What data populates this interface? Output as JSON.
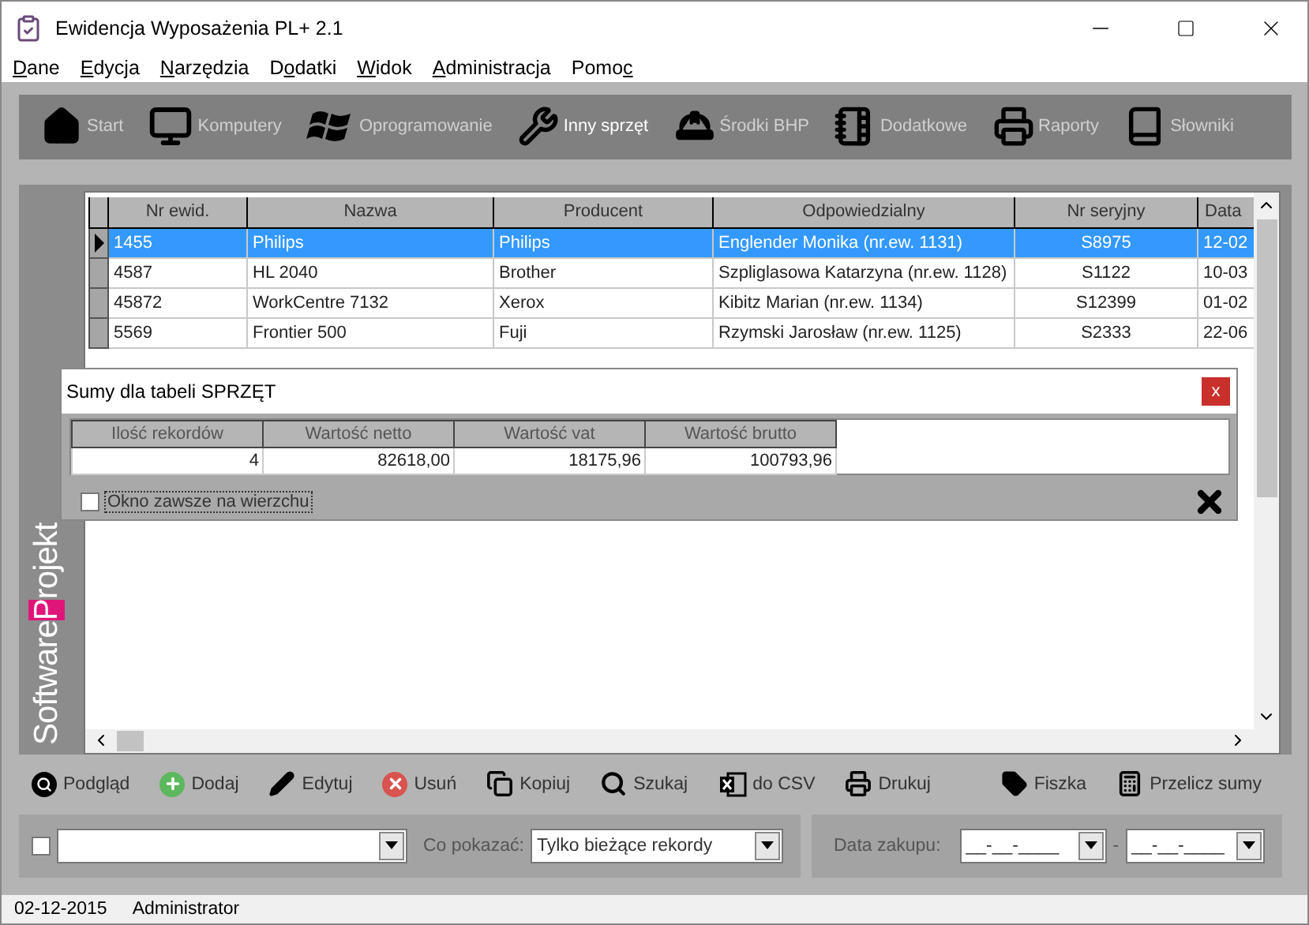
{
  "window": {
    "title": "Ewidencja Wyposażenia PL+ 2.1"
  },
  "menu": [
    {
      "key": "D",
      "after": "ane"
    },
    {
      "key": "E",
      "after": "dycja"
    },
    {
      "key": "N",
      "after": "arzędzia"
    },
    {
      "before": "D",
      "key": "o",
      "after": "datki"
    },
    {
      "key": "W",
      "after": "idok"
    },
    {
      "key": "A",
      "after": "dministracja"
    },
    {
      "before": "Pomo",
      "key": "c"
    }
  ],
  "toolbar": [
    {
      "label": "Start",
      "selected": false
    },
    {
      "label": "Komputery",
      "selected": false
    },
    {
      "label": "Oprogramowanie",
      "selected": false
    },
    {
      "label": "Inny sprzęt",
      "selected": true
    },
    {
      "label": "Środki BHP",
      "selected": false
    },
    {
      "label": "Dodatkowe",
      "selected": false
    },
    {
      "label": "Raporty",
      "selected": false
    },
    {
      "label": "Słowniki",
      "selected": false
    }
  ],
  "logo": {
    "before": "Software",
    "highlight": "P",
    "after": "rojekt"
  },
  "table": {
    "columns": [
      "Nr ewid.",
      "Nazwa",
      "Producent",
      "Odpowiedzialny",
      "Nr seryjny",
      "Data"
    ],
    "rows": [
      {
        "selected": true,
        "cells": [
          "1455",
          "Philips",
          "Philips",
          "Englender Monika (nr.ew. 1131)",
          "S8975",
          "12-02"
        ]
      },
      {
        "selected": false,
        "cells": [
          "4587",
          "HL 2040",
          "Brother",
          "Szpliglasowa Katarzyna (nr.ew. 1128)",
          "S1122",
          "10-03"
        ]
      },
      {
        "selected": false,
        "cells": [
          "45872",
          "WorkCentre 7132",
          "Xerox",
          "Kibitz Marian (nr.ew. 1134)",
          "S12399",
          "01-02"
        ]
      },
      {
        "selected": false,
        "cells": [
          "5569",
          "Frontier 500",
          "Fuji",
          "Rzymski Jarosław (nr.ew. 1125)",
          "S2333",
          "22-06"
        ]
      }
    ]
  },
  "sums_dialog": {
    "title": "Sumy dla tabeli SPRZĘT",
    "close": "x",
    "columns": [
      "Ilość rekordów",
      "Wartość netto",
      "Wartość vat",
      "Wartość brutto"
    ],
    "values": [
      "4",
      "82618,00",
      "18175,96",
      "100793,96"
    ],
    "always_on_top": {
      "label": "Okno zawsze na wierzchu",
      "checked": false
    }
  },
  "actions_left": [
    "Podgląd",
    "Dodaj",
    "Edytuj",
    "Usuń",
    "Kopiuj",
    "Szukaj",
    "do CSV",
    "Drukuj"
  ],
  "actions_right": [
    "Fiszka",
    "Przelicz sumy"
  ],
  "filter": {
    "checked": false,
    "show_label": "Co pokazać:",
    "show_value": "Tylko bieżące rekordy",
    "date_label": "Data zakupu:",
    "date_from": "__-__-____",
    "date_separator": "-",
    "date_to": "__-__-____"
  },
  "status_bar": [
    "02-12-2015",
    "Administrator"
  ]
}
